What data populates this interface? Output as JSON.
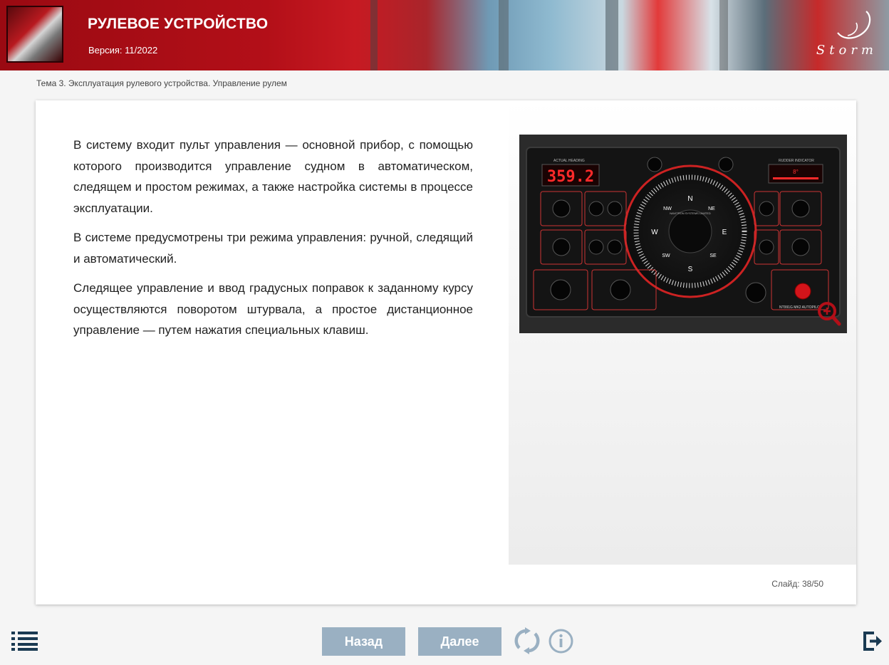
{
  "header": {
    "title": "РУЛЕВОЕ УСТРОЙСТВО",
    "version": "Версия: 11/2022",
    "brand": "Storm"
  },
  "breadcrumb": "Тема 3. Эксплуатация рулевого устройства. Управление рулем",
  "content": {
    "paragraphs": [
      "В систему входит пульт управления — основной прибор, с помощью которого производится управление судном в автоматическом, следящем и простом режимах, а также настройка системы в процессе эксплуатации.",
      "В системе предусмотрены три режима управления: ручной, следящий и автоматический.",
      "Следящее управление и ввод градусных поправок к заданному курсу осуществляются поворотом штурвала, а простое дистанционное управление — путем нажатия специальных клавиш."
    ]
  },
  "panel_image": {
    "heading_label": "ACTUAL HEADING",
    "heading_value": "359.2",
    "rudder_label": "RUDDER INDICATOR",
    "rudder_value": "8°",
    "brand_label": "NAVITRON SYSTEMS LIMITED",
    "model_label": "NT991G MK2 AUTOPILOT",
    "compass_marks": [
      "N",
      "NE",
      "E",
      "SE",
      "S",
      "SW",
      "W",
      "NW"
    ]
  },
  "slide": {
    "label": "Слайд:",
    "current": "38",
    "total": "50"
  },
  "nav": {
    "back": "Назад",
    "next": "Далее"
  },
  "colors": {
    "header_red": "#b30f18",
    "button_bg": "#9ab0c2",
    "icon_dark": "#1a3a52",
    "icon_light": "#9ab0c2"
  }
}
